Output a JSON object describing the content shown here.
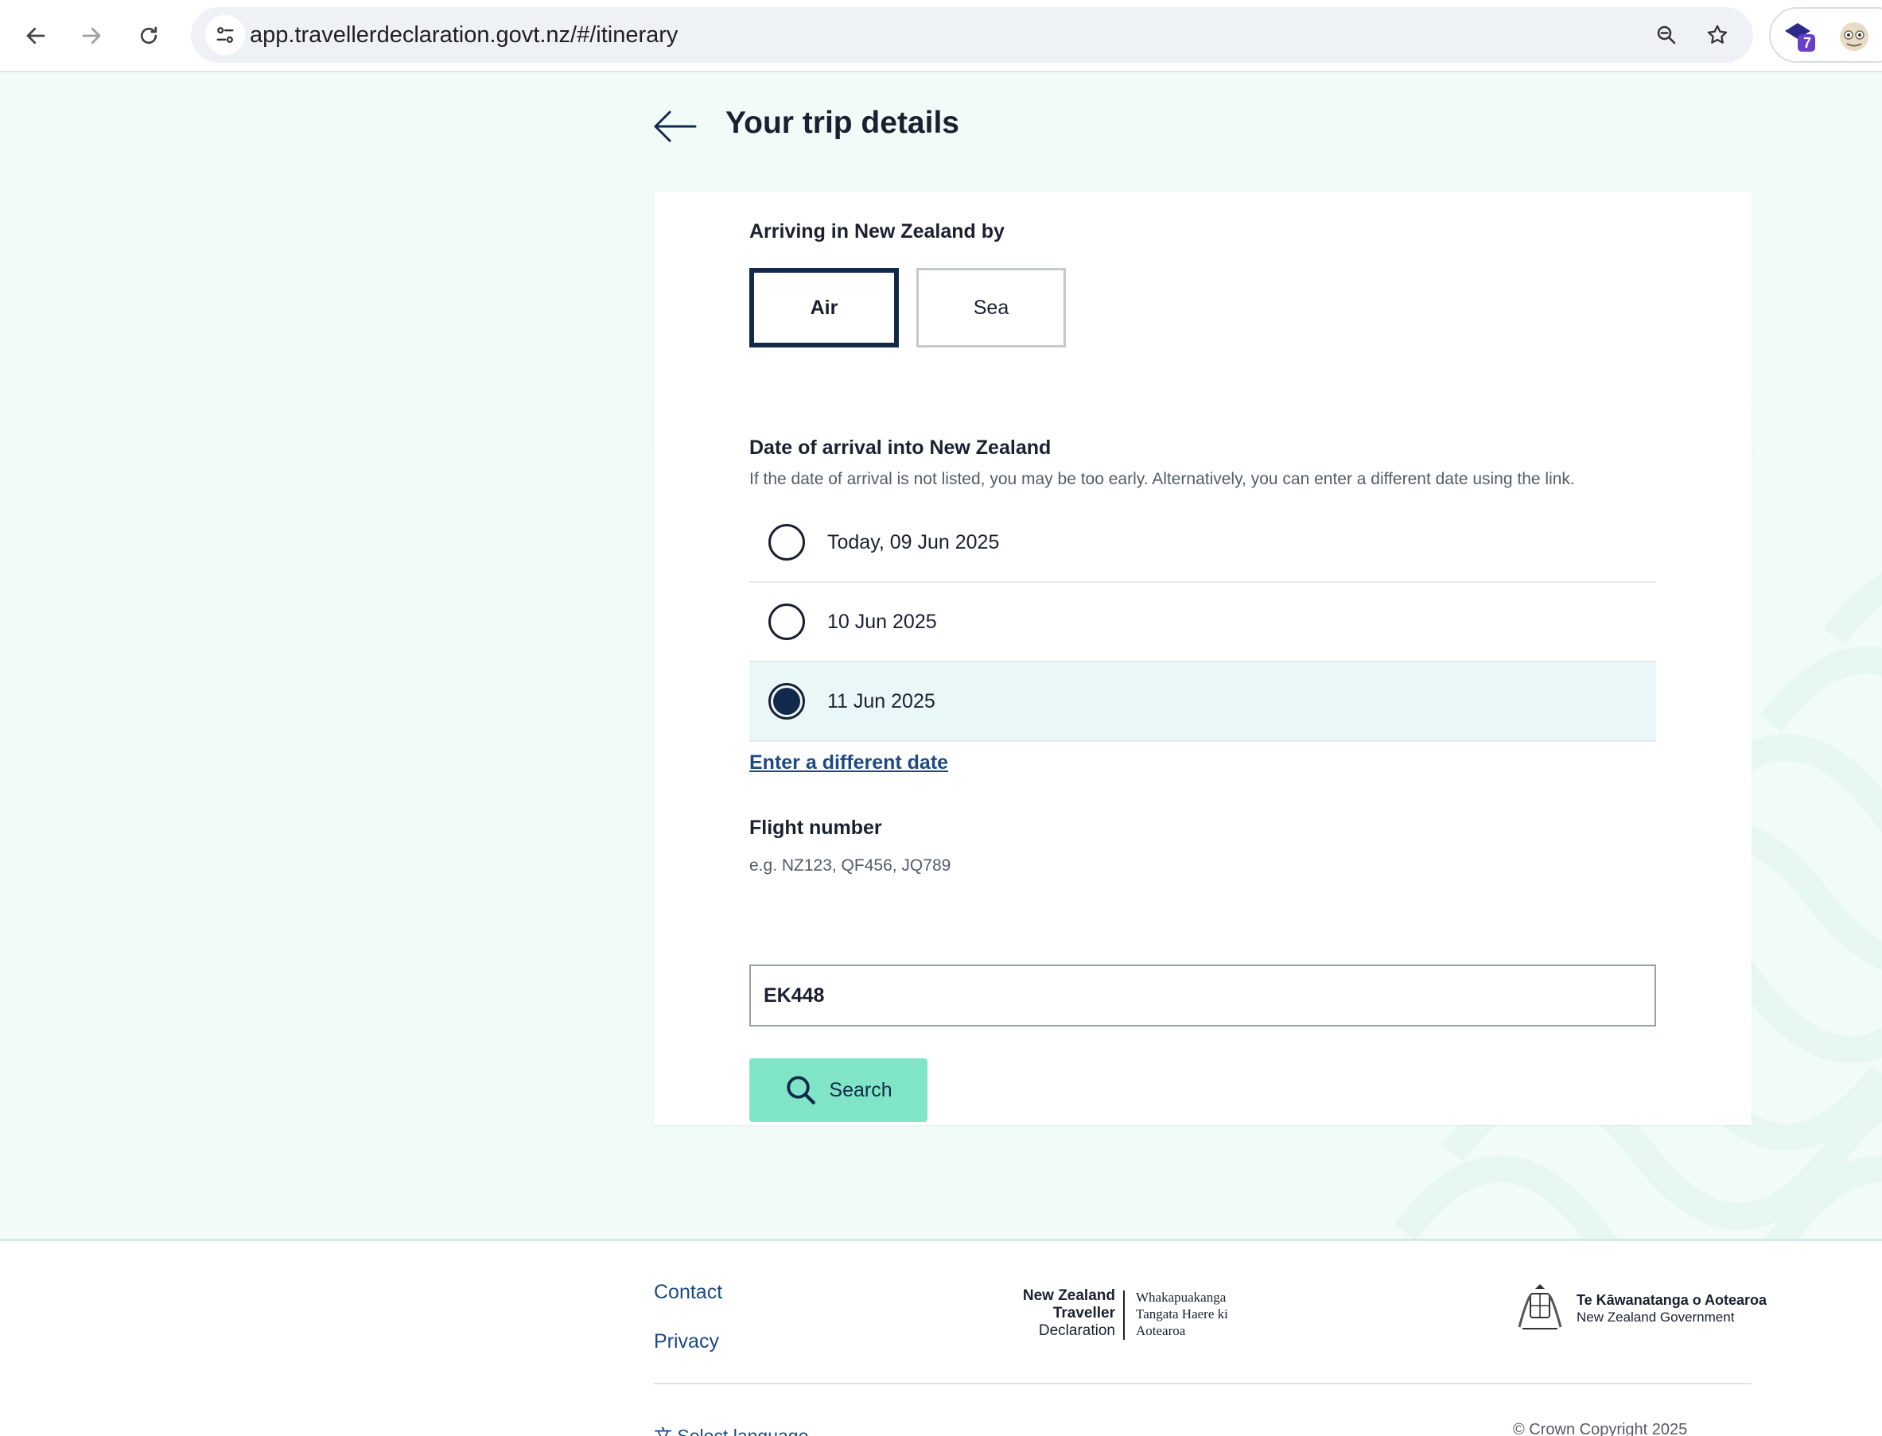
{
  "browser": {
    "url": "app.travellerdeclaration.govt.nz/#/itinerary",
    "extension_badge": "7"
  },
  "page": {
    "title": "Your trip details"
  },
  "arrival_mode": {
    "label": "Arriving in New Zealand by",
    "options": [
      "Air",
      "Sea"
    ],
    "selected": "Air"
  },
  "arrival_date": {
    "label": "Date of arrival into New Zealand",
    "hint": "If the date of arrival is not listed, you may be too early. Alternatively, you can enter a different date using the link.",
    "options": [
      "Today, 09 Jun 2025",
      "10 Jun 2025",
      "11 Jun 2025"
    ],
    "selected": "11 Jun 2025",
    "different_date_link": "Enter a different date"
  },
  "flight": {
    "label": "Flight number",
    "hint": "e.g. NZ123, QF456, JQ789",
    "value": "EK448",
    "search_label": "Search"
  },
  "footer": {
    "links": [
      "Contact",
      "Privacy"
    ],
    "logo_nztd": {
      "left": [
        "New Zealand",
        "Traveller",
        "Declaration"
      ],
      "right": [
        "Whakapuakanga",
        "Tangata Haere ki",
        "Aotearoa"
      ]
    },
    "gov_logo": {
      "line1": "Te Kāwanatanga o Aotearoa",
      "line2": "New Zealand Government"
    },
    "select_language": "Select language",
    "copyright": "© Crown Copyright 2025"
  },
  "colors": {
    "page_bg": "#f1fbf8",
    "navy": "#13294b",
    "link": "#1c4a84",
    "search_button": "#80e5c6",
    "selected_row": "#eaf7f8"
  }
}
